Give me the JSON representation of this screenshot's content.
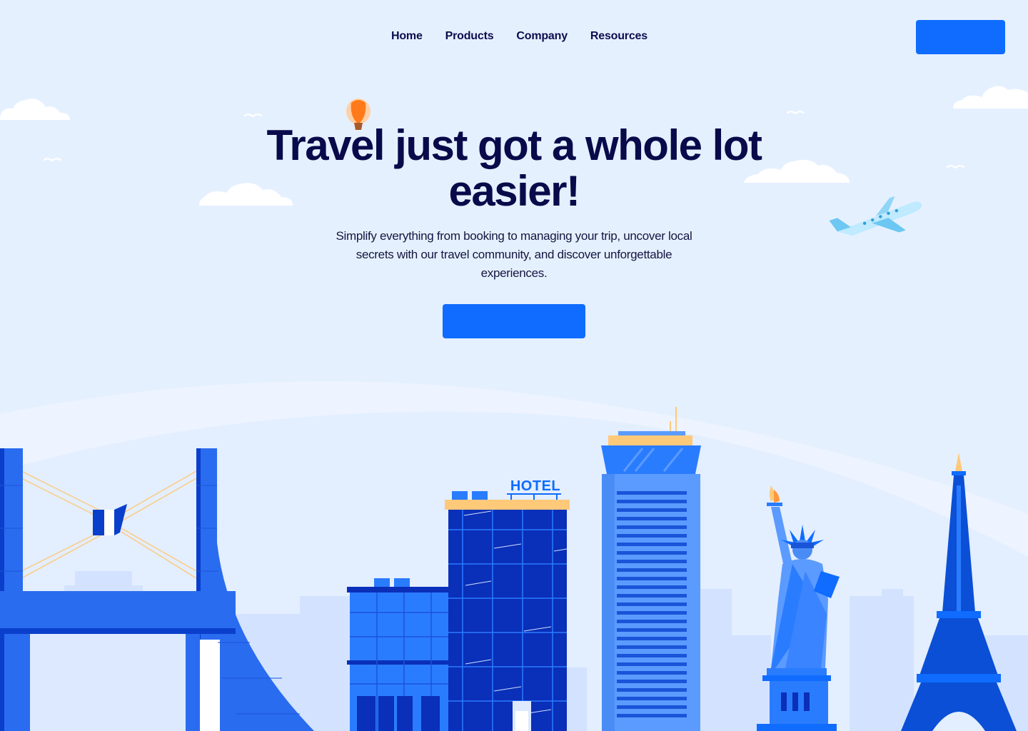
{
  "nav": {
    "links": [
      {
        "label": "Home"
      },
      {
        "label": "Products"
      },
      {
        "label": "Company"
      },
      {
        "label": "Resources"
      }
    ],
    "cta_label": ""
  },
  "hero": {
    "title": "Travel just got a whole lot easier!",
    "subtitle": "Simplify everything from booking to managing your trip, uncover local secrets with our travel community, and discover unforgettable experiences.",
    "cta_label": ""
  },
  "illustration": {
    "hotel_sign": "HOTEL"
  },
  "colors": {
    "background": "#e5f0ff",
    "primary": "#0f6cff",
    "heading": "#080a4a",
    "building_dark": "#0a2fb8",
    "building_mid": "#2a7cff",
    "building_light": "#5b9bff",
    "accent_gold": "#ffc97a",
    "balloon_orange": "#ff7a1a"
  }
}
